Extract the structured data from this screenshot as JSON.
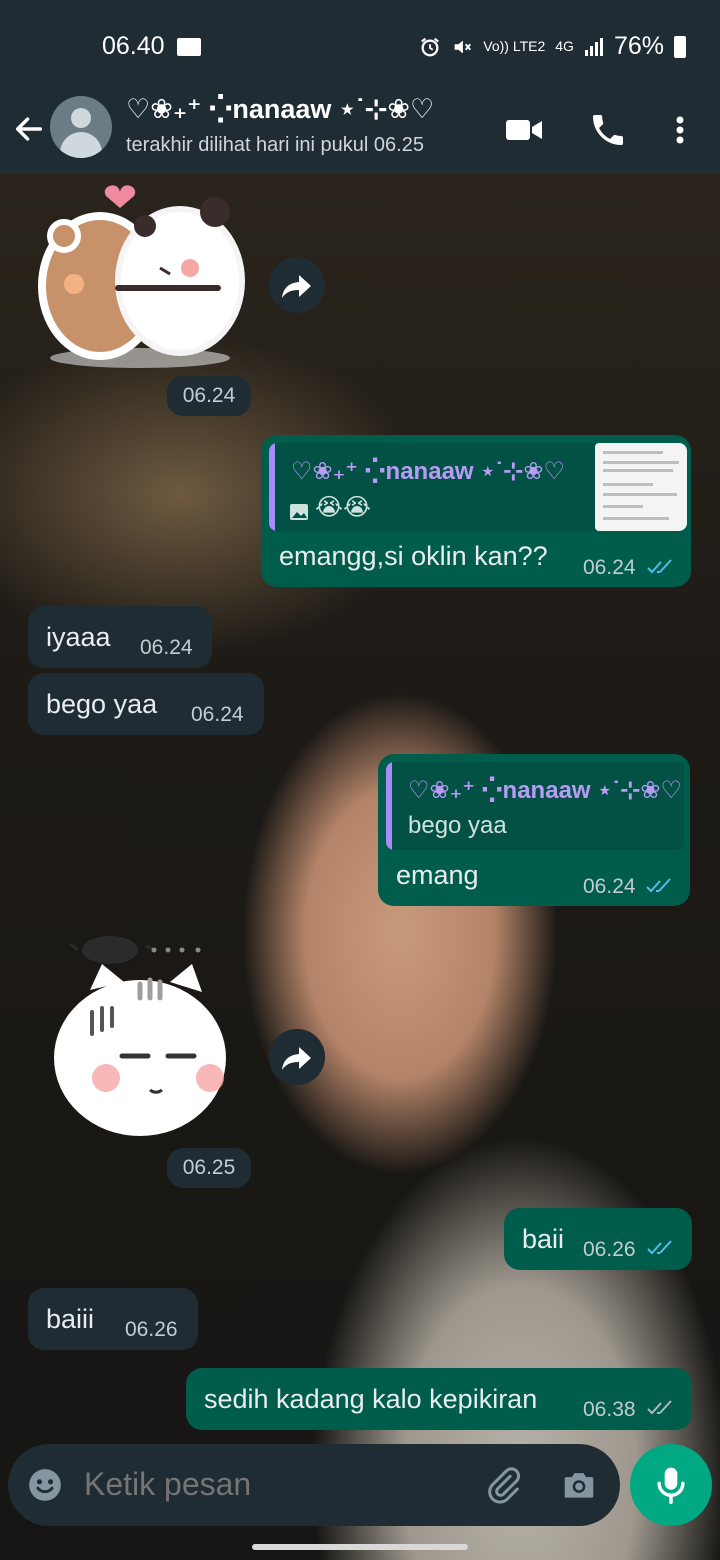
{
  "status_bar": {
    "time": "06.40",
    "volte": "Vo)) LTE2",
    "network": "4G",
    "battery": "76%"
  },
  "header": {
    "contact_name": "♡❀₊⁺ ⁛nanaaw ⋆˙⊹❀♡",
    "last_seen": "terakhir dilihat hari ini pukul 06.25"
  },
  "messages": [
    {
      "id": "sticker1",
      "type": "sticker",
      "direction": "in",
      "time": "06.24",
      "icon": "bear-panda-hug-sticker"
    },
    {
      "id": "m1",
      "direction": "out",
      "text": "emangg,si oklin kan??",
      "time": "06.24",
      "quote": {
        "author": "♡❀₊⁺ ⁛nanaaw ⋆˙⊹❀♡",
        "text": "😭😭",
        "icon": "image-icon"
      }
    },
    {
      "id": "m2",
      "direction": "in",
      "text": "iyaaa",
      "time": "06.24"
    },
    {
      "id": "m3",
      "direction": "in",
      "text": "bego yaa",
      "time": "06.24"
    },
    {
      "id": "m4",
      "direction": "out",
      "text": "emang",
      "time": "06.24",
      "quote": {
        "author": "♡❀₊⁺ ⁛nanaaw ⋆˙⊹❀♡",
        "text": "bego yaa"
      }
    },
    {
      "id": "sticker2",
      "type": "sticker",
      "direction": "in",
      "time": "06.25",
      "icon": "annoyed-cat-sticker"
    },
    {
      "id": "m5",
      "direction": "out",
      "text": "baii",
      "time": "06.26"
    },
    {
      "id": "m6",
      "direction": "in",
      "text": "baiii",
      "time": "06.26"
    },
    {
      "id": "m7",
      "direction": "out",
      "text": "sedih kadang kalo kepikiran",
      "time": "06.38"
    }
  ],
  "composer": {
    "placeholder": "Ketik pesan"
  },
  "colors": {
    "header_bg": "#1f2c34",
    "incoming_bubble": "#1f2c34",
    "outgoing_bubble": "#005c4b",
    "read_ticks": "#53bdeb",
    "mic_button": "#00a884"
  }
}
